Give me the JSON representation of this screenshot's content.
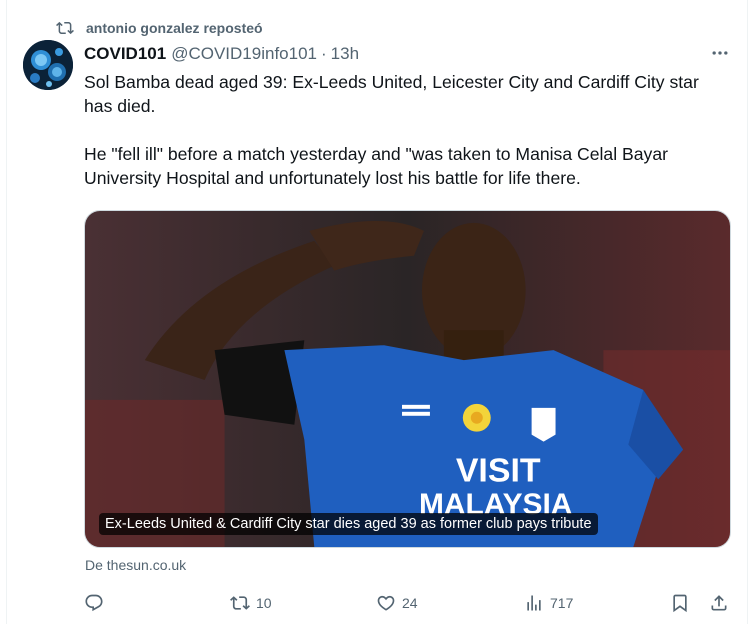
{
  "repost": {
    "text": "antonio gonzalez reposteó",
    "icon": "repost-icon"
  },
  "author": {
    "display_name": "COVID101",
    "handle": "@COVID19info101",
    "separator": "·",
    "time": "13h"
  },
  "tweet": {
    "text": "Sol Bamba dead aged 39: Ex-Leeds United, Leicester City and Cardiff City star has died.\n\nHe \"fell ill\" before a match yesterday and \"was taken to Manisa Celal Bayar University Hospital and unfortunately lost his battle for life there."
  },
  "media": {
    "caption": "Ex-Leeds United & Cardiff City star dies aged 39 as former club pays tribute",
    "shirt_text_1": "VISIT",
    "shirt_text_2": "MALAYSIA"
  },
  "source": "De thesun.co.uk",
  "actions": {
    "reply_count": "",
    "repost_count": "10",
    "like_count": "24",
    "views_count": "717"
  },
  "colors": {
    "text_primary": "#0f1419",
    "text_secondary": "#536471",
    "shirt_blue": "#1f5fbf",
    "border": "#cfd9de"
  }
}
